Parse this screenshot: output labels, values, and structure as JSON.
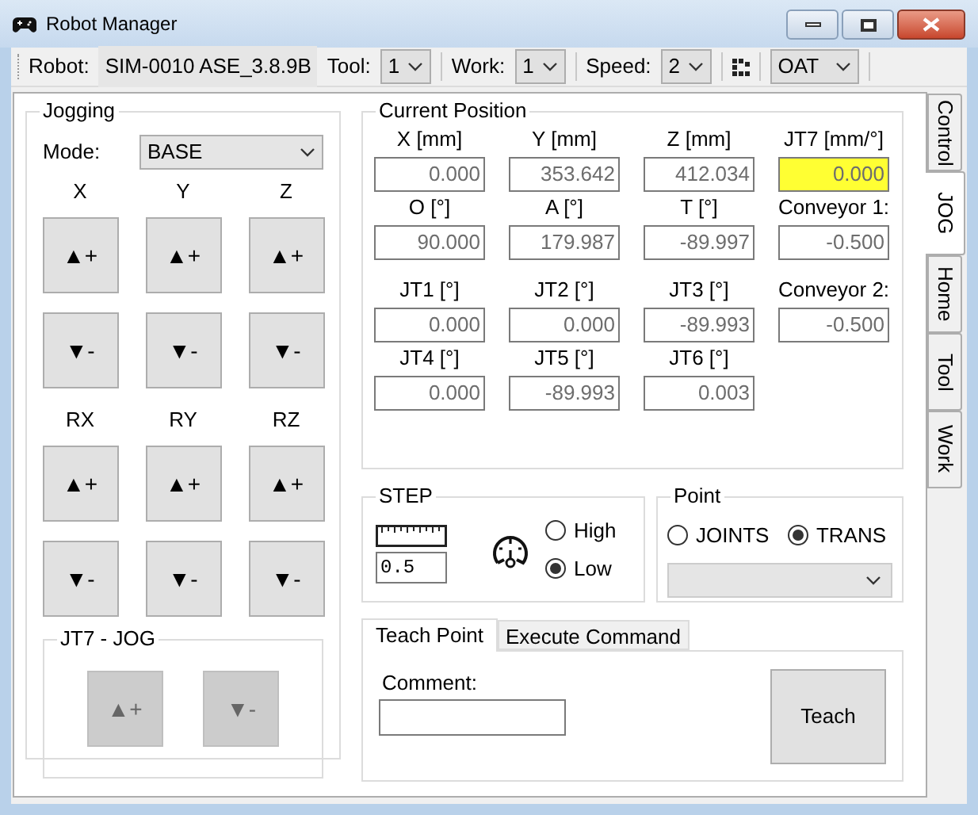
{
  "window": {
    "title": "Robot Manager"
  },
  "toolbar": {
    "robot_label": "Robot:",
    "robot_value": "SIM-0010 ASE_3.8.9B",
    "selects": [
      {
        "label": "Tool:",
        "value": "1"
      },
      {
        "label": "Work:",
        "value": "1"
      },
      {
        "label": "Speed:",
        "value": "2"
      }
    ],
    "config_value": "OAT"
  },
  "side_tabs": [
    {
      "label": "Control",
      "selected": false
    },
    {
      "label": "JOG",
      "selected": true
    },
    {
      "label": "Home",
      "selected": false
    },
    {
      "label": "Tool",
      "selected": false
    },
    {
      "label": "Work",
      "selected": false
    }
  ],
  "jogging": {
    "title": "Jogging",
    "mode_label": "Mode:",
    "mode_value": "BASE",
    "axes": [
      {
        "label": "X",
        "plus": "▲+",
        "minus": "▼-"
      },
      {
        "label": "Y",
        "plus": "▲+",
        "minus": "▼-"
      },
      {
        "label": "Z",
        "plus": "▲+",
        "minus": "▼-"
      },
      {
        "label": "RX",
        "plus": "▲+",
        "minus": "▼-"
      },
      {
        "label": "RY",
        "plus": "▲+",
        "minus": "▼-"
      },
      {
        "label": "RZ",
        "plus": "▲+",
        "minus": "▼-"
      }
    ],
    "jt7": {
      "title": "JT7 - JOG",
      "buttons": [
        {
          "label": "▲+",
          "disabled": true
        },
        {
          "label": "▼-",
          "disabled": true
        }
      ]
    }
  },
  "current_position": {
    "title": "Current Position",
    "rows": [
      [
        {
          "label": "X [mm]",
          "value": "0.000",
          "highlighted": false
        },
        {
          "label": "Y [mm]",
          "value": "353.642",
          "highlighted": false
        },
        {
          "label": "Z  [mm]",
          "value": "412.034",
          "highlighted": false
        },
        {
          "label": "JT7 [mm/°]",
          "value": "0.000",
          "highlighted": true
        }
      ],
      [
        {
          "label": "O [°]",
          "value": "90.000",
          "highlighted": false
        },
        {
          "label": "A [°]",
          "value": "179.987",
          "highlighted": false
        },
        {
          "label": "T [°]",
          "value": "-89.997",
          "highlighted": false
        },
        {
          "label": "Conveyor 1:",
          "value": "-0.500",
          "highlighted": false
        }
      ],
      [
        {
          "label": "JT1 [°]",
          "value": "0.000",
          "highlighted": false
        },
        {
          "label": "JT2 [°]",
          "value": "0.000",
          "highlighted": false
        },
        {
          "label": "JT3 [°]",
          "value": "-89.993",
          "highlighted": false
        },
        {
          "label": "Conveyor 2:",
          "value": "-0.500",
          "highlighted": false
        }
      ],
      [
        {
          "label": "JT4 [°]",
          "value": "0.000",
          "highlighted": false
        },
        {
          "label": "JT5 [°]",
          "value": "-89.993",
          "highlighted": false
        },
        {
          "label": "JT6 [°]",
          "value": "0.003",
          "highlighted": false
        }
      ]
    ]
  },
  "step": {
    "title": "STEP",
    "value": "0.5",
    "speeds": [
      {
        "label": "High",
        "selected": false
      },
      {
        "label": "Low",
        "selected": true
      }
    ]
  },
  "point": {
    "title": "Point",
    "types": [
      {
        "label": "JOINTS",
        "selected": false
      },
      {
        "label": "TRANS",
        "selected": true
      }
    ]
  },
  "command_tabs": [
    {
      "label": "Teach Point",
      "selected": true
    },
    {
      "label": "Execute Command",
      "selected": false
    }
  ],
  "teach": {
    "comment_label": "Comment:",
    "button": "Teach"
  }
}
